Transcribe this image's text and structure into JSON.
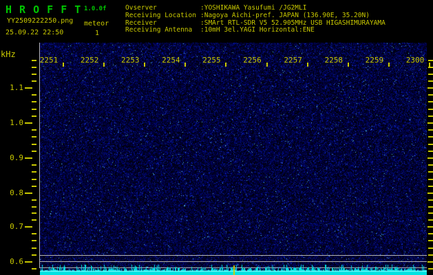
{
  "header": {
    "title": "H R O F F T",
    "version": "1.0.0f",
    "filename": "YY2509222250.png",
    "mode": "meteor",
    "datetime": "25.09.22 22:50",
    "count": "1"
  },
  "station_info": {
    "rows": [
      {
        "label": "Ovserver",
        "value": ":YOSHIKAWA Yasufumi /JG2MLI"
      },
      {
        "label": "Receiving Location",
        "value": ":Nagoya Aichi-pref. JAPAN (136.90E, 35.20N)"
      },
      {
        "label": "Receiver",
        "value": ":SMArt RTL-SDR V5 52.905MHz USB HIGASHIMURAYAMA"
      },
      {
        "label": "Receiving Antenna",
        "value": ":10mH 3el.YAGI Horizontal:ENE"
      }
    ]
  },
  "chart_data": {
    "type": "heatmap",
    "description": "10-minute radio meteor observation spectrogram (HROFFT waterfall). Blue background noise only; no meteor echo traces visible. Bottom strip shows cyan signal-level trace with three gray reference lines and one yellow event marker near 22:55.",
    "x_axis": {
      "unit": "time hhmm",
      "labels": [
        "2251",
        "2252",
        "2253",
        "2254",
        "2255",
        "2256",
        "2257",
        "2258",
        "2259",
        "2300"
      ]
    },
    "y_axis": {
      "unit": "kHz",
      "labels": [
        "1.1",
        "1.0",
        "0.9",
        "0.8",
        "0.7",
        "0.6"
      ]
    },
    "legend": "none",
    "grid": "off",
    "signal_strip": {
      "reference_lines": 3,
      "marker": "yellow vertical tick near 2255"
    }
  },
  "colors": {
    "background": "#000000",
    "title_green": "#00c400",
    "text_yellow": "#c9c900",
    "axis_gray": "#b4b4b4",
    "noise_blue": "#0000a0",
    "trace_cyan": "#00e2e2",
    "marker_yellow": "#d2d200"
  }
}
